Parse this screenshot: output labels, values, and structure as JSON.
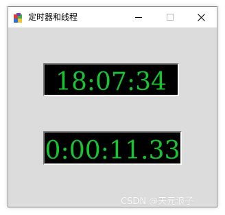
{
  "window": {
    "title": "定时器和线程",
    "icon": "app-icon"
  },
  "controls": {
    "minimize_icon": "minimize-icon",
    "maximize_icon": "maximize-icon",
    "close_icon": "close-icon"
  },
  "clock": {
    "time": "18:07:34"
  },
  "timer": {
    "elapsed": "0:00:11.33"
  },
  "colors": {
    "display_background": "#000000",
    "display_text": "#19c432",
    "window_background": "#dcdcdc"
  },
  "watermark": "CSDN @天元浪子"
}
